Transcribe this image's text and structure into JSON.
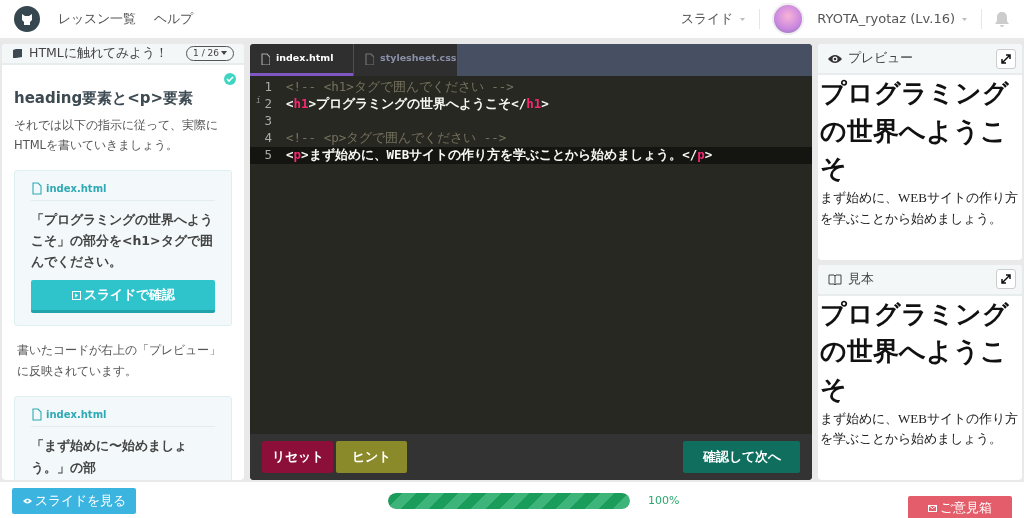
{
  "navbar": {
    "links": [
      {
        "label": "レッスン一覧"
      },
      {
        "label": "ヘルプ"
      }
    ],
    "mode": "スライド",
    "user": "RYOTA_ryotaz (Lv.16)"
  },
  "lesson": {
    "title": "HTMLに触れてみよう！",
    "page": "1 / 26",
    "heading": "heading要素と<p>要素",
    "completed": true,
    "intro": "それでは以下の指示に従って、実際にHTMLを書いていきましょう。",
    "tasks": [
      {
        "file": "index.html",
        "text": "「プログラミングの世界へようこそ」の部分を<h1>タグで囲んでください。",
        "button": "スライドで確認"
      },
      {
        "kind": "note",
        "text": "書いたコードが右上の「プレビュー」に反映されています。"
      },
      {
        "file": "index.html",
        "text": "「まず始めに〜始めましょう。」の部"
      }
    ]
  },
  "editor": {
    "tabs": [
      {
        "label": "index.html",
        "selected": true
      },
      {
        "label": "stylesheet.css",
        "selected": false
      }
    ],
    "lines": [
      {
        "number": "1",
        "active": false,
        "tokens": [
          {
            "kind": "comment",
            "text": "<!-- <h1>タグで囲んでください -->"
          }
        ]
      },
      {
        "number": "2",
        "active": false,
        "gutter_mark": "i",
        "tokens": [
          {
            "kind": "punct",
            "text": "<"
          },
          {
            "kind": "tag",
            "text": "h1"
          },
          {
            "kind": "punct",
            "text": ">"
          },
          {
            "kind": "text",
            "text": "プログラミングの世界へようこそ"
          },
          {
            "kind": "punct",
            "text": "</"
          },
          {
            "kind": "tag",
            "text": "h1"
          },
          {
            "kind": "punct",
            "text": ">"
          }
        ]
      },
      {
        "number": "3",
        "active": false
      },
      {
        "number": "4",
        "active": false,
        "tokens": [
          {
            "kind": "comment",
            "text": "<!-- <p>タグで囲んでください -->"
          }
        ]
      },
      {
        "number": "5",
        "active": true,
        "tokens": [
          {
            "kind": "punct",
            "text": "<"
          },
          {
            "kind": "tag",
            "text": "p"
          },
          {
            "kind": "punct",
            "text": ">"
          },
          {
            "kind": "text",
            "text": "まず始めに、WEBサイトの作り方を学ぶことから始めましょう。"
          },
          {
            "kind": "punct",
            "text": "</"
          },
          {
            "kind": "tag",
            "text": "p"
          },
          {
            "kind": "punct",
            "text": ">"
          }
        ]
      }
    ],
    "buttons": [
      {
        "kind": "reset",
        "label": "リセット"
      },
      {
        "kind": "hint",
        "label": "ヒント"
      },
      {
        "kind": "submit",
        "label": "確認して次へ"
      }
    ]
  },
  "panels": [
    {
      "kind": "preview",
      "title": "プレビュー",
      "h1": "プログラミングの世界へようこそ",
      "p": "まず始めに、WEBサイトの作り方を学ぶことから始めましょう。"
    },
    {
      "kind": "sample",
      "title": "見本",
      "h1": "プログラミングの世界へようこそ",
      "p": "まず始めに、WEBサイトの作り方を学ぶことから始めましょう。"
    }
  ],
  "footer": {
    "slides_button": "スライドを見る",
    "progress": {
      "level": 1.0,
      "reading": "100%"
    },
    "feedback_button": "ご意見箱"
  }
}
